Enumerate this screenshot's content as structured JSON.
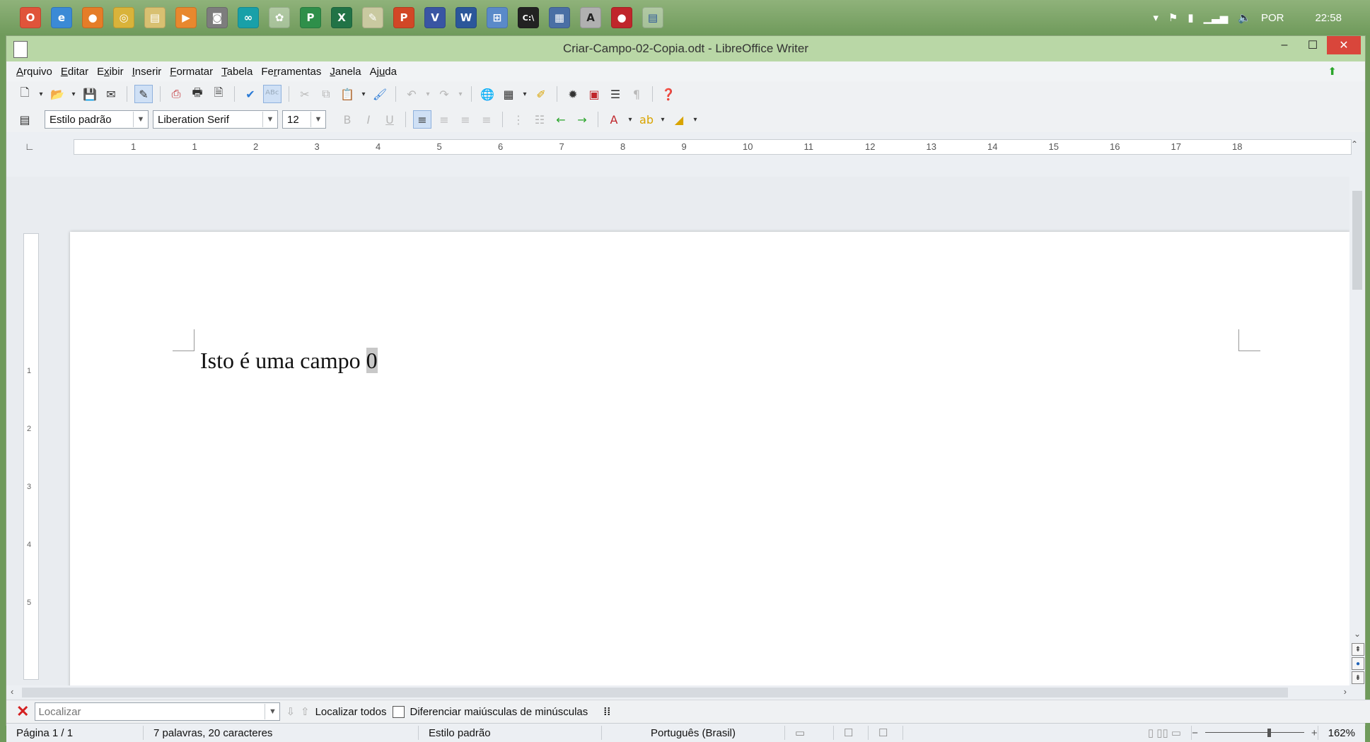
{
  "taskbar": {
    "icons": [
      "opera-icon",
      "ie-icon",
      "firefox-icon",
      "chrome-icon",
      "explorer-icon",
      "media-icon",
      "camera-icon",
      "arduino-icon",
      "paint-icon",
      "publisher-icon",
      "excel-icon",
      "notepad-icon",
      "powerpoint-icon",
      "visio-icon",
      "word-icon",
      "network-icon",
      "cmd-icon",
      "calculator-icon",
      "acrobat-icon",
      "red-app-icon",
      "writer-icon"
    ],
    "tray_language": "POR",
    "clock": "22:58"
  },
  "window": {
    "title": "Criar-Campo-02-Copia.odt - LibreOffice Writer"
  },
  "menu": [
    {
      "label": "Arquivo",
      "mnemonic": "A"
    },
    {
      "label": "Editar",
      "mnemonic": "E"
    },
    {
      "label": "Exibir",
      "mnemonic": "x"
    },
    {
      "label": "Inserir",
      "mnemonic": "I"
    },
    {
      "label": "Formatar",
      "mnemonic": "F"
    },
    {
      "label": "Tabela",
      "mnemonic": "T"
    },
    {
      "label": "Ferramentas",
      "mnemonic": "r"
    },
    {
      "label": "Janela",
      "mnemonic": "J"
    },
    {
      "label": "Ajuda",
      "mnemonic": "u"
    }
  ],
  "formatting": {
    "paragraph_style": "Estilo padrão",
    "font_name": "Liberation Serif",
    "font_size": "12"
  },
  "ruler": {
    "ticks": [
      "1",
      "1",
      "2",
      "3",
      "4",
      "5",
      "6",
      "7",
      "8",
      "9",
      "10",
      "11",
      "12",
      "13",
      "14",
      "15",
      "16",
      "17",
      "18"
    ]
  },
  "vertical_ruler": {
    "ticks": [
      "1",
      "2",
      "3",
      "4",
      "5"
    ]
  },
  "document": {
    "text": "Isto é uma campo ",
    "field_value": "0"
  },
  "findbar": {
    "placeholder": "Localizar",
    "find_all": "Localizar todos",
    "match_case": "Diferenciar maiúsculas de minúsculas"
  },
  "status": {
    "page": "Página 1 / 1",
    "words": "7 palavras, 20 caracteres",
    "page_style": "Estilo padrão",
    "language": "Português (Brasil)",
    "zoom": "162%"
  },
  "colors": {
    "taskbar": "#7da66a",
    "titlebar": "#b9d7a6",
    "close": "#d9463b",
    "field_shading": "#c8c8c8"
  }
}
